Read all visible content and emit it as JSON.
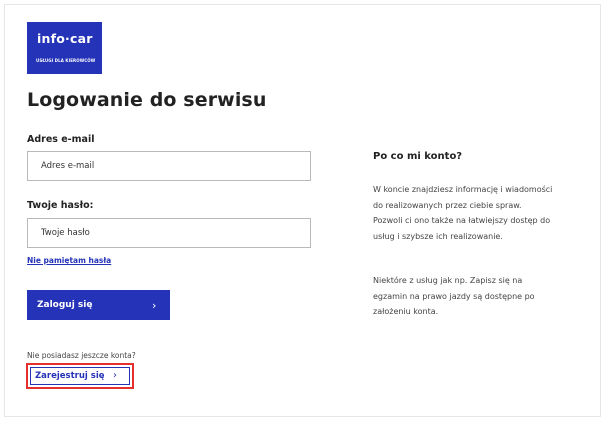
{
  "logo": {
    "brand": "info·car",
    "tagline": "USŁUGI DLA KIEROWCÓW"
  },
  "page_title": "Logowanie do serwisu",
  "form": {
    "email_label": "Adres e-mail",
    "email_placeholder": "Adres e-mail",
    "password_label": "Twoje hasło:",
    "password_placeholder": "Twoje hasło",
    "forgot_link": "Nie pamiętam hasła",
    "login_button": "Zaloguj się",
    "login_chevron": "›"
  },
  "register": {
    "prompt": "Nie posiadasz jeszcze konta?",
    "button": "Zarejestruj się",
    "chevron": "›"
  },
  "sidebar": {
    "title": "Po co mi konto?",
    "paragraph1": "W koncie znajdziesz informację i wiadomości do realizowanych przez ciebie spraw. Pozwoli ci ono także na łatwiejszy dostęp do usług i szybsze ich realizowanie.",
    "paragraph2": "Niektóre z usług jak np. Zapisz się na egzamin na prawo jazdy są dostępne po założeniu konta."
  },
  "colors": {
    "brand": "#2433b8",
    "highlight": "#e53030"
  }
}
